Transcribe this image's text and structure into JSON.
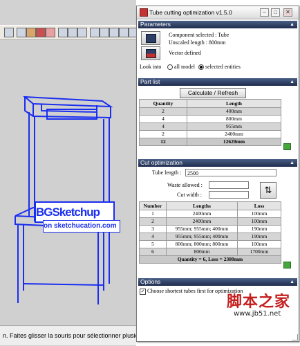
{
  "sketchup": {
    "toolbar_icons": [
      "orbit-icon",
      "select-icon",
      "component-icon",
      "paint-icon",
      "eraser-icon",
      "rect-icon",
      "push-icon",
      "move-icon",
      "rotate-icon",
      "offset-icon",
      "tape-icon",
      "text-icon",
      "zoom-icon"
    ],
    "model_label": "BGSketchup",
    "model_url": "on sketchucation.com",
    "status_text": "n. Faites glisser la souris pour sélectionner plusie"
  },
  "window": {
    "title": "Tube cutting optimization v1.5.0"
  },
  "parameters": {
    "header": "Parameters",
    "component_selected": "Component selected : Tube",
    "unscaled_length": "Unscaled length : 800mm",
    "vector_defined": "Vector defined",
    "look_into_label": "Look into",
    "radio_all": "all model",
    "radio_selected": "selected entities",
    "selected_radio": "selected entities"
  },
  "part_list": {
    "header": "Part list",
    "button": "Calculate / Refresh",
    "columns": [
      "Quantity",
      "Length"
    ],
    "rows": [
      {
        "quantity": "2",
        "length": "400mm"
      },
      {
        "quantity": "4",
        "length": "800mm"
      },
      {
        "quantity": "4",
        "length": "955mm"
      },
      {
        "quantity": "2",
        "length": "2400mm"
      }
    ],
    "total": {
      "quantity": "12",
      "length": "12620mm"
    }
  },
  "cut_optimization": {
    "header": "Cut optimization",
    "tube_length_label": "Tube length :",
    "tube_length_value": "2500",
    "waste_label": "Waste allowed :",
    "cut_width_label": "Cut width :",
    "columns": [
      "Number",
      "Lengths",
      "Loss"
    ],
    "rows": [
      {
        "number": "1",
        "lengths": "2400mm",
        "loss": "100mm"
      },
      {
        "number": "2",
        "lengths": "2400mm",
        "loss": "100mm"
      },
      {
        "number": "3",
        "lengths": "955mm; 955mm; 400mm",
        "loss": "190mm"
      },
      {
        "number": "4",
        "lengths": "955mm; 955mm; 400mm",
        "loss": "190mm"
      },
      {
        "number": "5",
        "lengths": "800mm; 800mm; 800mm",
        "loss": "100mm"
      },
      {
        "number": "6",
        "lengths": "800mm",
        "loss": "1700mm"
      }
    ],
    "summary": "Quantity = 6, Loss = 2380mm"
  },
  "options": {
    "header": "Options",
    "checkbox_label": "Choose shortest tubes first for optimization",
    "checked": true
  },
  "watermark": {
    "text": "脚本之家",
    "url": "www.jb51.net"
  },
  "colors": {
    "section_header": "#1f2d4f",
    "model_blue": "#1a2ef0",
    "watermark_red": "#c42020"
  }
}
